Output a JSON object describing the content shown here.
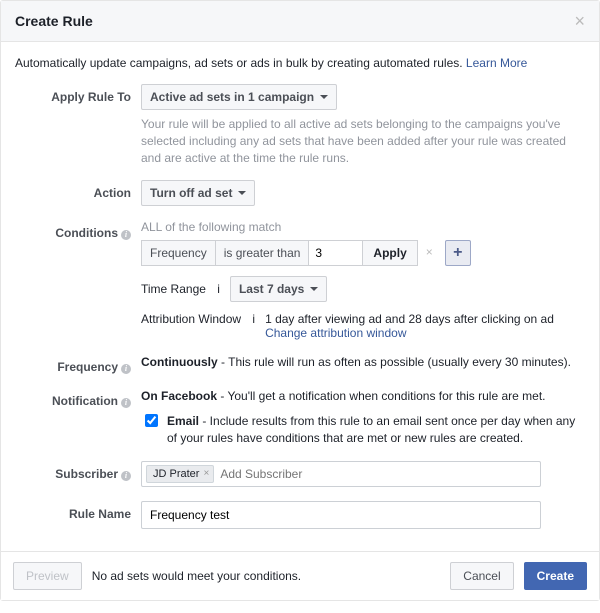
{
  "header": {
    "title": "Create Rule"
  },
  "intro": {
    "text": "Automatically update campaigns, ad sets or ads in bulk by creating automated rules. ",
    "link": "Learn More"
  },
  "labels": {
    "applyRuleTo": "Apply Rule To",
    "action": "Action",
    "conditions": "Conditions",
    "frequency": "Frequency",
    "notification": "Notification",
    "subscriber": "Subscriber",
    "ruleName": "Rule Name"
  },
  "applyRuleTo": {
    "value": "Active ad sets in 1 campaign",
    "hint": "Your rule will be applied to all active ad sets belonging to the campaigns you've selected including any ad sets that have been added after your rule was created and are active at the time the rule runs."
  },
  "action": {
    "value": "Turn off ad set"
  },
  "conditions": {
    "allMatch": "ALL of the following match",
    "metric": "Frequency",
    "operator": "is greater than",
    "threshold": "3",
    "applyBtn": "Apply",
    "timeRangeLabel": "Time Range",
    "timeRangeValue": "Last 7 days",
    "attribLabel": "Attribution Window",
    "attribText": "1 day after viewing ad and 28 days after clicking on ad",
    "attribLink": "Change attribution window"
  },
  "frequency": {
    "label": "Continuously",
    "desc": " - This rule will run as often as possible (usually every 30 minutes)."
  },
  "notification": {
    "label": "On Facebook",
    "desc": " - You'll get a notification when conditions for this rule are met.",
    "emailLabel": "Email",
    "emailDesc": " - Include results from this rule to an email sent once per day when any of your rules have conditions that are met or new rules are created."
  },
  "subscriber": {
    "token": "JD Prater",
    "placeholder": "Add Subscriber"
  },
  "ruleName": {
    "value": "Frequency test"
  },
  "footer": {
    "preview": "Preview",
    "message": "No ad sets would meet your conditions.",
    "cancel": "Cancel",
    "create": "Create"
  }
}
